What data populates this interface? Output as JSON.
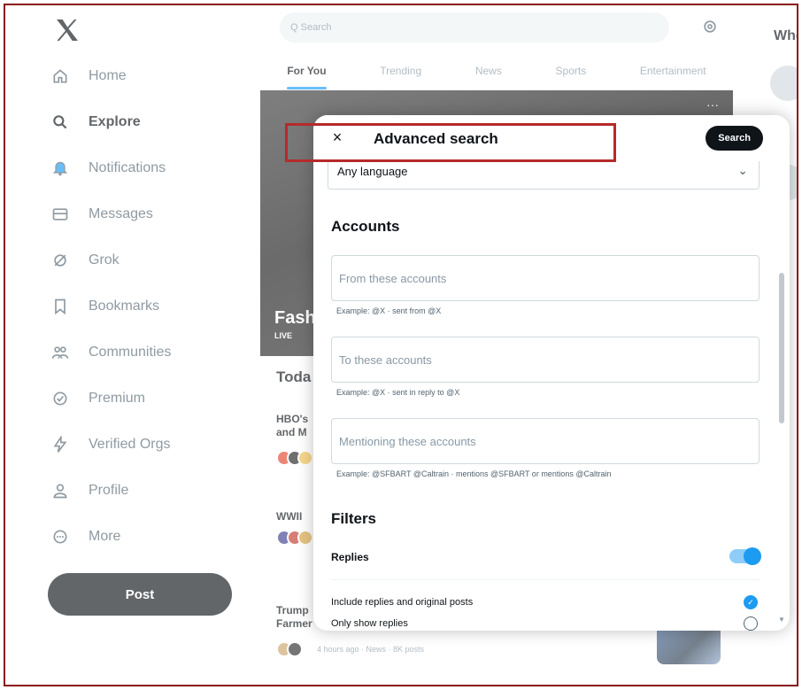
{
  "sidebar": {
    "items": [
      {
        "label": "Home"
      },
      {
        "label": "Explore"
      },
      {
        "label": "Notifications"
      },
      {
        "label": "Messages"
      },
      {
        "label": "Grok"
      },
      {
        "label": "Bookmarks"
      },
      {
        "label": "Communities"
      },
      {
        "label": "Premium"
      },
      {
        "label": "Verified Orgs"
      },
      {
        "label": "Profile"
      },
      {
        "label": "More"
      }
    ],
    "post_label": "Post"
  },
  "header": {
    "search_placeholder": "Q Search",
    "tabs": [
      {
        "label": "For You"
      },
      {
        "label": "Trending"
      },
      {
        "label": "News"
      },
      {
        "label": "Sports"
      },
      {
        "label": "Entertainment"
      }
    ]
  },
  "feed": {
    "hero_title": "Fash",
    "hero_live": "LIVE",
    "hero_more": "···",
    "section_title": "Toda",
    "stories": [
      {
        "title_line1": "HBO's",
        "title_line2": "and M"
      },
      {
        "title_line1": "WWII"
      },
      {
        "title_line1": "Trump",
        "title_line2": "Farmer"
      }
    ],
    "last_meta": "4 hours ago · News · 8K posts"
  },
  "right": {
    "title": "Who"
  },
  "modal": {
    "title": "Advanced search",
    "close": "×",
    "search_label": "Search",
    "language_value": "Any language",
    "accounts_title": "Accounts",
    "from_placeholder": "From these accounts",
    "from_hint": "Example: @X · sent from @X",
    "to_placeholder": "To these accounts",
    "to_hint": "Example: @X · sent in reply to @X",
    "mention_placeholder": "Mentioning these accounts",
    "mention_hint": "Example: @SFBART @Caltrain · mentions @SFBART or mentions @Caltrain",
    "filters_title": "Filters",
    "replies_label": "Replies",
    "replies_on": true,
    "option1": "Include replies and original posts",
    "option2": "Only show replies"
  },
  "colors": {
    "accent": "#1d9bf0",
    "highlight": "#b52b2b",
    "frame": "#8b1a1a"
  }
}
